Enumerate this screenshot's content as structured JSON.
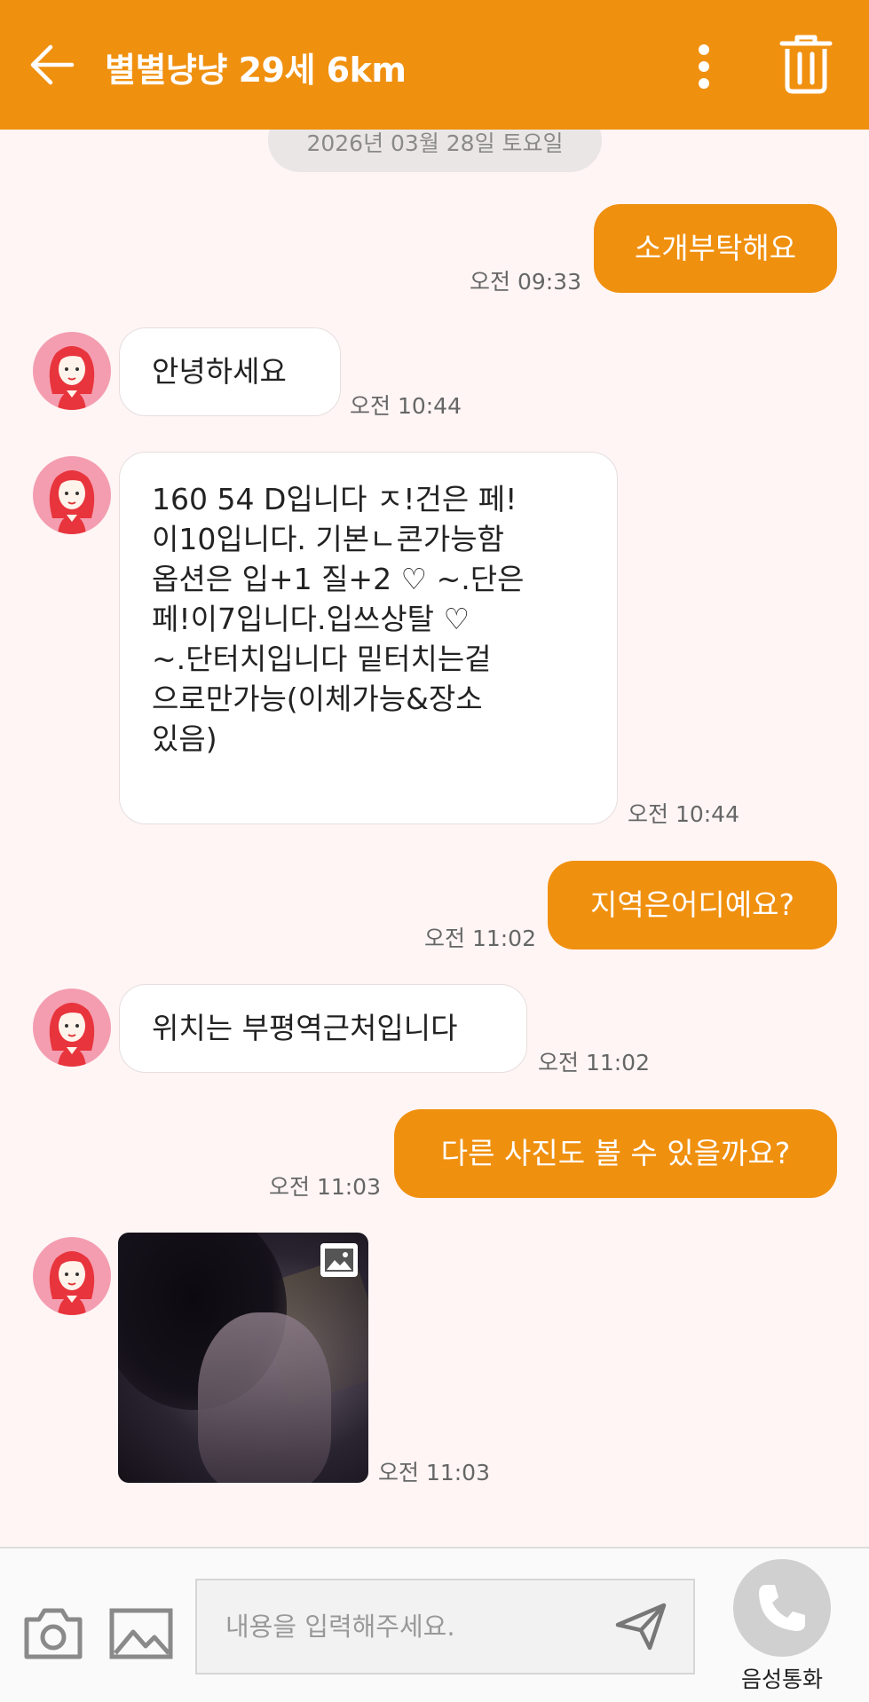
{
  "header": {
    "title": "별별냥냥 29세 6km",
    "background": "#f0900f",
    "icons": [
      "back-arrow-icon",
      "more-vertical-icon",
      "trash-icon"
    ]
  },
  "chat": {
    "date_divider": "2026년 03월 28일 토요일",
    "messages": [
      {
        "from": "me",
        "text": "소개부탁해요",
        "time": "오전 09:33"
      },
      {
        "from": "them",
        "text": "안녕하세요",
        "time": "오전 10:44"
      },
      {
        "from": "them",
        "lines": [
          "160 54 D입니다 ㅈ!건은 페!",
          "이10입니다. 기본ㄴ콘가능함",
          "옵션은 입+1 질+2 ♡ ~.단은",
          "페!이7입니다.입쓰상탈 ♡",
          "~.단터치입니다 밑터치는겉",
          "으로만가능(이체가능&장소",
          "있음)"
        ],
        "time": "오전 10:44"
      },
      {
        "from": "me",
        "text": "지역은어디예요?",
        "time": "오전 11:02"
      },
      {
        "from": "them",
        "text": "위치는 부평역근처입니다",
        "time": "오전 11:02"
      },
      {
        "from": "me",
        "text": "다른 사진도 볼 수 있을까요?",
        "time": "오전 11:03"
      },
      {
        "from": "them",
        "type": "image",
        "time": "오전 11:03"
      }
    ],
    "accent": "#f0900f",
    "avatar_color": "#f49db0"
  },
  "composer": {
    "placeholder": "내용을 입력해주세요.",
    "value": "",
    "call_label": "음성통화",
    "icons": [
      "camera-icon",
      "image-icon",
      "send-icon",
      "phone-icon"
    ]
  }
}
